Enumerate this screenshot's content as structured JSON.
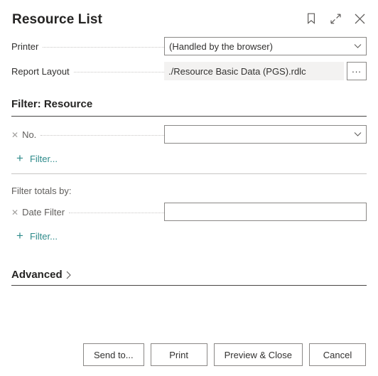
{
  "header": {
    "title": "Resource List",
    "actions": [
      {
        "name": "bookmark-icon",
        "label": "Bookmark"
      },
      {
        "name": "expand-icon",
        "label": "Expand"
      },
      {
        "name": "close-icon",
        "label": "Close"
      }
    ]
  },
  "options": {
    "printer": {
      "label": "Printer",
      "value": "(Handled by the browser)",
      "placeholder": ""
    },
    "report_layout": {
      "label": "Report Layout",
      "value": "./Resource Basic Data (PGS).rdlc",
      "assist_label": "..."
    }
  },
  "filter_resource": {
    "heading": "Filter: Resource",
    "rows": [
      {
        "label": "No.",
        "value": "",
        "placeholder": ""
      }
    ],
    "add_filter_label": "Filter..."
  },
  "filter_totals": {
    "heading": "Filter totals by:",
    "rows": [
      {
        "label": "Date Filter",
        "value": "",
        "placeholder": ""
      }
    ],
    "add_filter_label": "Filter..."
  },
  "advanced": {
    "label": "Advanced"
  },
  "footer": {
    "buttons": [
      {
        "label": "Send to..."
      },
      {
        "label": "Print"
      },
      {
        "label": "Preview & Close"
      },
      {
        "label": "Cancel"
      }
    ]
  },
  "colors": {
    "accent_link": "#2e8b8b",
    "rule_dark": "#484644",
    "rule_light": "#c8c6c4",
    "field_border": "#8a8886",
    "flat_field_bg": "#f3f2f1"
  }
}
